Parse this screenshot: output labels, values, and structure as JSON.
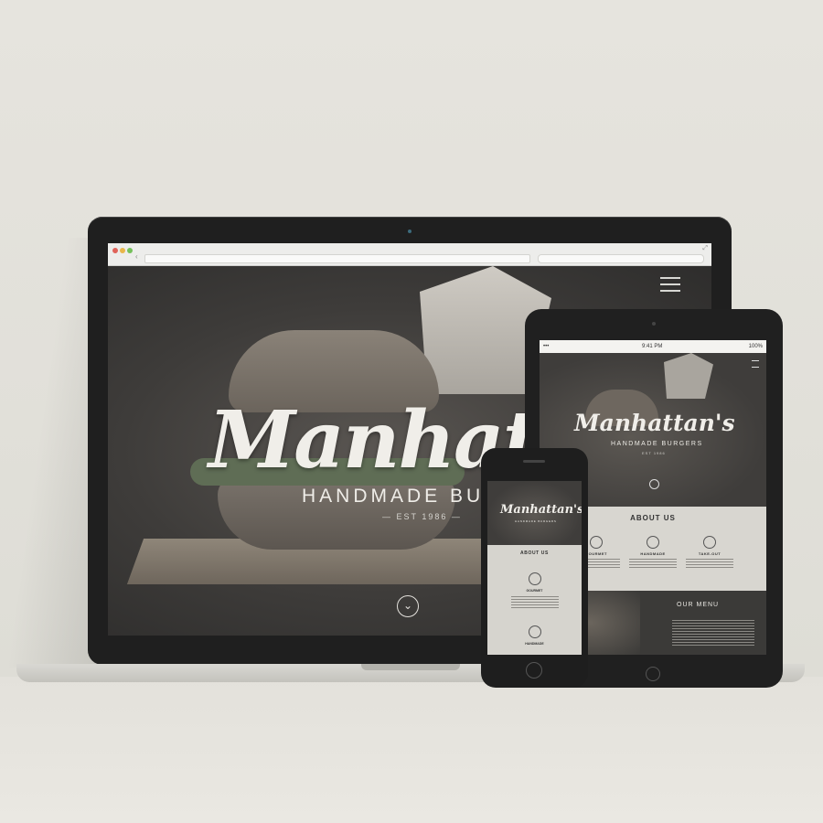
{
  "laptop": {
    "brand_name": "Manhattan's",
    "tagline": "HANDMADE BURGERS",
    "established": "— EST 1986 —"
  },
  "tablet": {
    "status_time": "9:41 PM",
    "status_battery": "100%",
    "brand_name": "Manhattan's",
    "tagline": "HANDMADE BURGERS",
    "established": "EST 1986",
    "about_title": "ABOUT US",
    "features": [
      "GOURMET",
      "HANDMADE",
      "TAKE-OUT"
    ],
    "menu_title": "OUR MENU"
  },
  "phone": {
    "brand_name": "Manhattan's",
    "tagline": "HANDMADE BURGERS",
    "about_title": "ABOUT US",
    "features": [
      "GOURMET",
      "HANDMADE"
    ]
  },
  "colors": {
    "background": "#e4e2dc",
    "device_frame": "#1f1f1f",
    "hero_text": "#f0eee9"
  }
}
